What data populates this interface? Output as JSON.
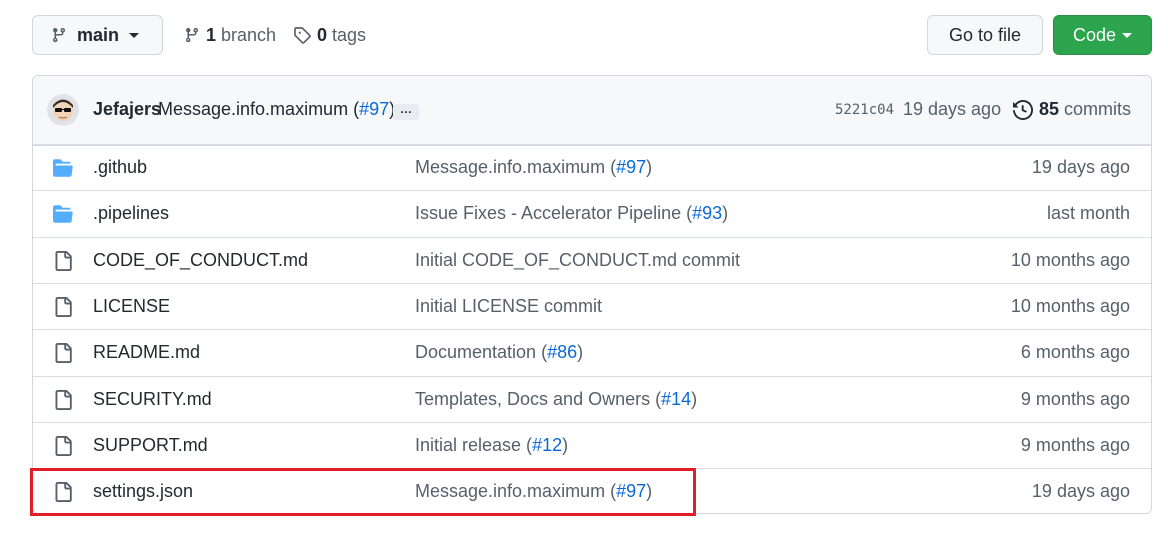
{
  "branch": {
    "current": "main"
  },
  "counts": {
    "branches_count": "1",
    "branches_label": "branch",
    "tags_count": "0",
    "tags_label": "tags"
  },
  "actions": {
    "goto_file": "Go to file",
    "code": "Code"
  },
  "latest_commit": {
    "author": "Jefajers",
    "message": "Message.info.maximum (",
    "pr": "#97",
    "message_end": ")",
    "ellipsis": "…",
    "sha": "5221c04",
    "age": "19 days ago",
    "commits_count": "85",
    "commits_label": "commits"
  },
  "files": [
    {
      "type": "folder",
      "name": ".github",
      "msg": "Message.info.maximum (",
      "pr": "#97",
      "msg_end": ")",
      "age": "19 days ago"
    },
    {
      "type": "folder",
      "name": ".pipelines",
      "msg": "Issue Fixes - Accelerator Pipeline (",
      "pr": "#93",
      "msg_end": ")",
      "age": "last month"
    },
    {
      "type": "file",
      "name": "CODE_OF_CONDUCT.md",
      "msg": "Initial CODE_OF_CONDUCT.md commit",
      "pr": "",
      "msg_end": "",
      "age": "10 months ago"
    },
    {
      "type": "file",
      "name": "LICENSE",
      "msg": "Initial LICENSE commit",
      "pr": "",
      "msg_end": "",
      "age": "10 months ago"
    },
    {
      "type": "file",
      "name": "README.md",
      "msg": "Documentation (",
      "pr": "#86",
      "msg_end": ")",
      "age": "6 months ago"
    },
    {
      "type": "file",
      "name": "SECURITY.md",
      "msg": "Templates, Docs and Owners (",
      "pr": "#14",
      "msg_end": ")",
      "age": "9 months ago"
    },
    {
      "type": "file",
      "name": "SUPPORT.md",
      "msg": "Initial release (",
      "pr": "#12",
      "msg_end": ")",
      "age": "9 months ago"
    },
    {
      "type": "file",
      "name": "settings.json",
      "msg": "Message.info.maximum (",
      "pr": "#97",
      "msg_end": ")",
      "age": "19 days ago"
    }
  ],
  "colors": {
    "accent": "#0969da",
    "code_green": "#2da44e",
    "folder": "#54aeff",
    "highlight": "#e11d2a"
  },
  "icons": {
    "branch": "git-branch-icon",
    "tag": "tag-icon",
    "history": "history-icon",
    "folder": "folder-icon",
    "file": "file-icon"
  }
}
